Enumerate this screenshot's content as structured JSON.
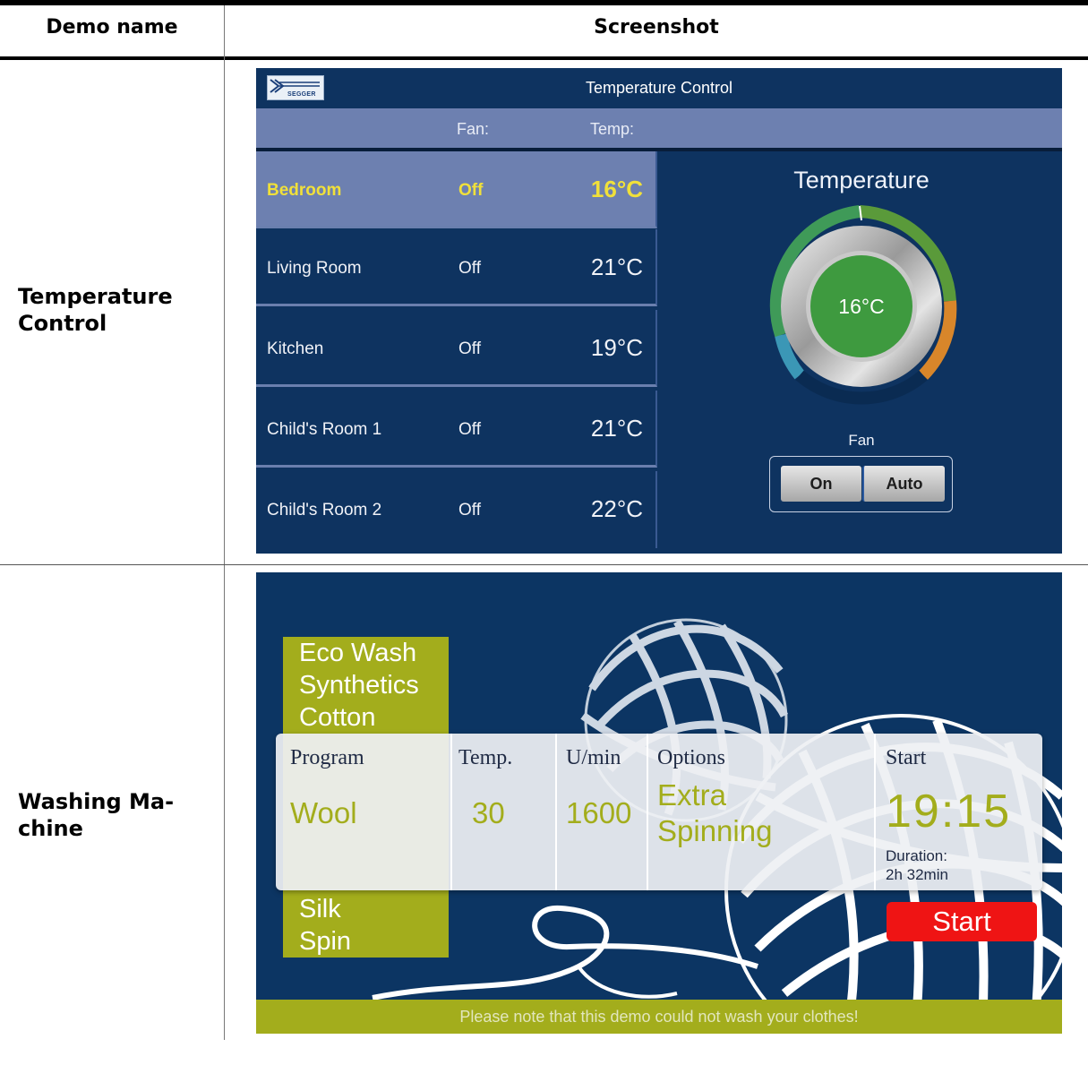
{
  "table": {
    "headers": {
      "demo_name": "Demo name",
      "screenshot": "Screenshot"
    },
    "rows": [
      {
        "name": "Temperature Control"
      },
      {
        "name": "Washing Ma-chine"
      }
    ]
  },
  "temperature_control": {
    "logo_text": "SEGGER",
    "title": "Temperature Control",
    "header": {
      "fan": "Fan:",
      "temp": "Temp:"
    },
    "rooms": [
      {
        "name": "Bedroom",
        "fan": "Off",
        "temp": "16°C"
      },
      {
        "name": "Living Room",
        "fan": "Off",
        "temp": "21°C"
      },
      {
        "name": "Kitchen",
        "fan": "Off",
        "temp": "19°C"
      },
      {
        "name": "Child's Room 1",
        "fan": "Off",
        "temp": "21°C"
      },
      {
        "name": "Child's Room 2",
        "fan": "Off",
        "temp": "22°C"
      }
    ],
    "selected_room": "Bedroom",
    "gauge": {
      "label": "Temperature",
      "value": "16°C"
    },
    "fan_control": {
      "label": "Fan",
      "on": "On",
      "auto": "Auto"
    },
    "colors": {
      "background": "#0e3360",
      "selected": "#6d80b0",
      "highlight": "#f0e03a",
      "gauge_center": "#3e9a3f"
    }
  },
  "washing_machine": {
    "programs": [
      "Eco Wash",
      "Synthetics",
      "Cotton",
      "Silk",
      "Spin"
    ],
    "columns": {
      "program": {
        "header": "Program",
        "value": "Wool"
      },
      "temp": {
        "header": "Temp.",
        "value": "30"
      },
      "speed": {
        "header": "U/min",
        "value": "1600"
      },
      "options": {
        "header": "Options",
        "value_line1": "Extra",
        "value_line2": "Spinning"
      },
      "start": {
        "header": "Start",
        "time": "19:15",
        "duration_label": "Duration:",
        "duration_value": "2h 32min"
      }
    },
    "start_button": "Start",
    "footer": "Please note that this demo could not wash your clothes!",
    "colors": {
      "background": "#0c3563",
      "accent": "#a3ad1c",
      "start": "#ef1414"
    }
  }
}
